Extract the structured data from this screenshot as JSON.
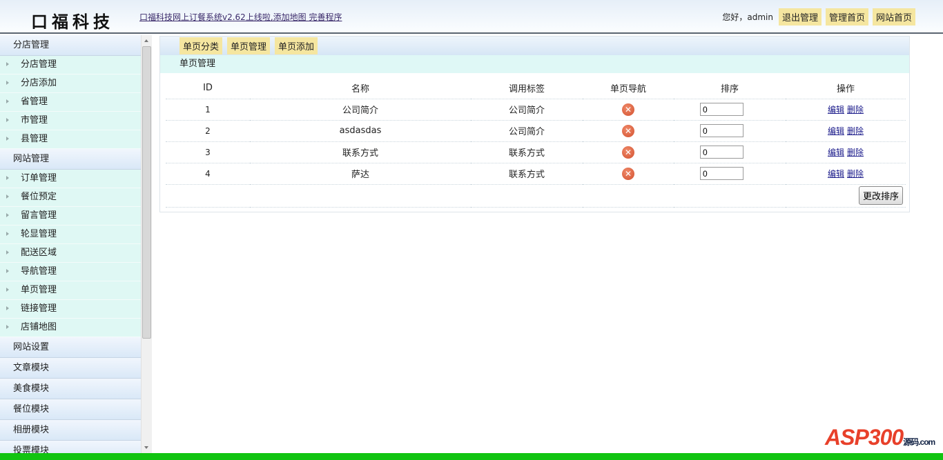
{
  "header": {
    "logo": "口福科技",
    "notice": "口福科技网上订餐系统v2.62上线啦,添加地图 完善程序",
    "greeting": "您好，admin",
    "buttons": [
      "退出管理",
      "管理首页",
      "网站首页"
    ]
  },
  "sidebar": {
    "groups": [
      {
        "title": "分店管理",
        "items": [
          "分店管理",
          "分店添加",
          "省管理",
          "市管理",
          "县管理"
        ]
      },
      {
        "title": "网站管理",
        "items": [
          "订单管理",
          "餐位预定",
          "留言管理",
          "轮显管理",
          "配送区域",
          "导航管理",
          "单页管理",
          "链接管理",
          "店铺地图"
        ]
      },
      {
        "title": "网站设置",
        "items": []
      },
      {
        "title": "文章模块",
        "items": []
      },
      {
        "title": "美食模块",
        "items": []
      },
      {
        "title": "餐位模块",
        "items": []
      },
      {
        "title": "相册模块",
        "items": []
      },
      {
        "title": "投票模块",
        "items": []
      }
    ]
  },
  "main": {
    "tabs": [
      "单页分类",
      "单页管理",
      "单页添加"
    ],
    "title": "单页管理",
    "columns": [
      "ID",
      "名称",
      "调用标签",
      "单页导航",
      "排序",
      "操作"
    ],
    "rows": [
      {
        "id": "1",
        "name": "公司简介",
        "tag": "公司简介",
        "nav": "no",
        "sort": "0"
      },
      {
        "id": "2",
        "name": "asdasdas",
        "tag": "公司简介",
        "nav": "no",
        "sort": "0"
      },
      {
        "id": "3",
        "name": "联系方式",
        "tag": "联系方式",
        "nav": "no",
        "sort": "0"
      },
      {
        "id": "4",
        "name": "萨达",
        "tag": "联系方式",
        "nav": "no",
        "sort": "0"
      }
    ],
    "edit_label": "编辑",
    "delete_label": "删除",
    "submit_label": "更改排序"
  },
  "watermark": {
    "text": "ASP300",
    "sub": "源码.com"
  }
}
